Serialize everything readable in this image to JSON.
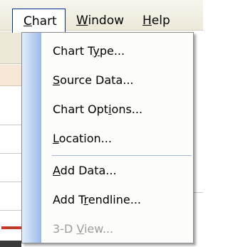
{
  "menubar": {
    "items": [
      {
        "pre": "",
        "key": "C",
        "post": "hart"
      },
      {
        "pre": "",
        "key": "W",
        "post": "indow"
      },
      {
        "pre": "",
        "key": "H",
        "post": "elp"
      }
    ]
  },
  "chart_menu": {
    "items": [
      {
        "pre": "Chart T",
        "key": "y",
        "post": "pe...",
        "enabled": true
      },
      {
        "pre": "",
        "key": "S",
        "post": "ource Data...",
        "enabled": true
      },
      {
        "pre": "Chart Opt",
        "key": "i",
        "post": "ons...",
        "enabled": true
      },
      {
        "pre": "",
        "key": "L",
        "post": "ocation...",
        "enabled": true
      },
      {
        "pre": "",
        "key": "A",
        "post": "dd Data...",
        "enabled": true
      },
      {
        "pre": "Add T",
        "key": "r",
        "post": "endline...",
        "enabled": true
      },
      {
        "pre": "3-D ",
        "key": "V",
        "post": "iew...",
        "enabled": false
      }
    ]
  },
  "colors": {
    "menu_highlight_border": "#002d96",
    "gutter_start": "#e3edfb",
    "gutter_end": "#9bb9ea",
    "disabled_text": "#9d9d9d"
  }
}
